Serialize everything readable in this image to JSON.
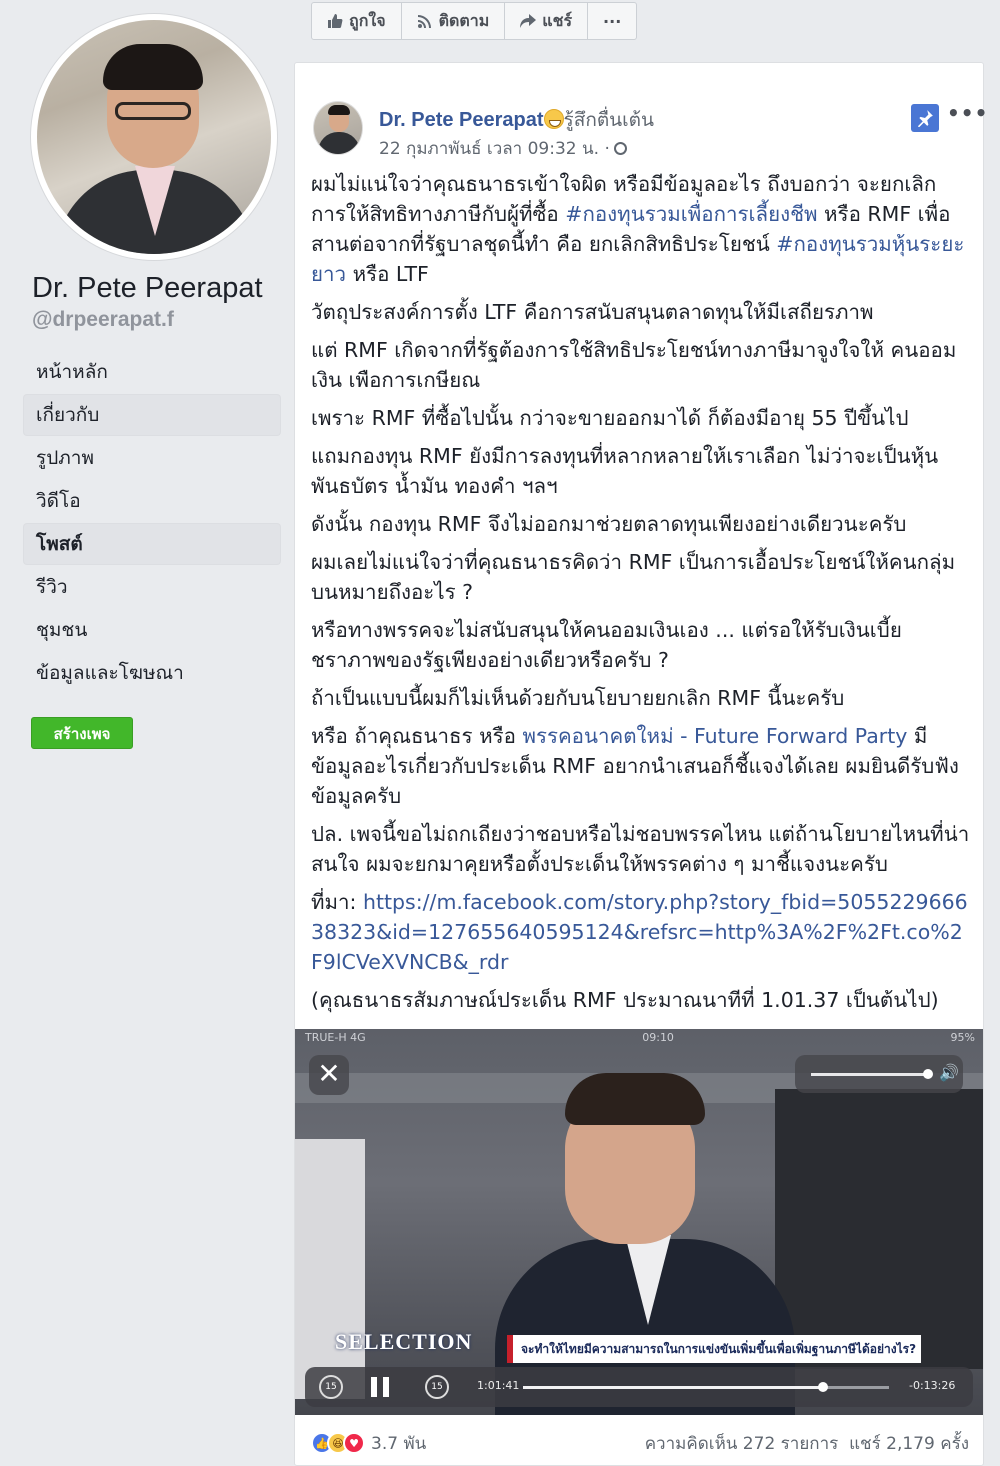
{
  "page": {
    "name": "Dr. Pete Peerapat",
    "handle": "@drpeerapat.f",
    "nav": [
      "หน้าหลัก",
      "เกี่ยวกับ",
      "รูปภาพ",
      "วิดีโอ",
      "โพสต์",
      "รีวิว",
      "ชุมชน",
      "ข้อมูลและโฆษณา"
    ],
    "create_page_label": "สร้างเพจ"
  },
  "topbar": {
    "like_label": "ถูกใจ",
    "follow_label": "ติดตาม",
    "share_label": "แชร์",
    "more_label": "···"
  },
  "post": {
    "author": "Dr. Pete Peerapat",
    "feeling": "รู้สึกตื่นเต้น",
    "timestamp": "22 กุมภาพันธ์ เวลา 09:32 น. ·",
    "more_label": "•••",
    "p1a": "ผมไม่แน่ใจว่าคุณธนาธรเข้าใจผิด หรือมีข้อมูลอะไร ถึงบอกว่า จะยกเลิกการให้สิทธิทางภาษีกับผู้ที่ซื้อ ",
    "hashtag1": "#กองทุนรวมเพื่อการเลี้ยงชีพ",
    "p1b": " หรือ RMF เพื่อสานต่อจากที่รัฐบาลชุดนี้ทำ คือ ยกเลิกสิทธิประโยชน์ ",
    "hashtag2": "#กองทุนรวมหุ้นระยะยาว",
    "p1c": " หรือ LTF",
    "p2": "วัตถุประสงค์การตั้ง LTF คือการสนับสนุนตลาดทุนให้มีเสถียรภาพ",
    "p3": "แต่ RMF เกิดจากที่รัฐต้องการใช้สิทธิประโยชน์ทางภาษีมาจูงใจให้ คนออมเงิน เพือการเกษียณ",
    "p4": "เพราะ RMF ที่ซื้อไปนั้น กว่าจะขายออกมาได้ ก็ต้องมีอายุ 55 ปีขึ้นไป",
    "p5": "แถมกองทุน RMF ยังมีการลงทุนที่หลากหลายให้เราเลือก ไม่ว่าจะเป็นหุ้น พันธบัตร น้ำมัน ทองคำ ฯลฯ",
    "p6": "ดังนั้น กองทุน RMF จึงไม่ออกมาช่วยตลาดทุนเพียงอย่างเดียวนะครับ",
    "p7": "ผมเลยไม่แน่ใจว่าที่คุณธนาธรคิดว่า RMF เป็นการเอื้อประโยชน์ให้คนกลุ่มบนหมายถึงอะไร ?",
    "p8": "หรือทางพรรคจะไม่สนับสนุนให้คนออมเงินเอง ... แต่รอให้รับเงินเบี้ยชราภาพของรัฐเพียงอย่างเดียวหรือครับ ?",
    "p9": "ถ้าเป็นแบบนี้ผมก็ไม่เห็นด้วยกับนโยบายยกเลิก RMF นี้นะครับ",
    "p10a": "หรือ ถ้าคุณธนาธร หรือ ",
    "p10link": "พรรคอนาคตใหม่ - Future Forward Party",
    "p10b": " มีข้อมูลอะไรเกี่ยวกับประเด็น RMF อยากนำเสนอก็ชี้แจงได้เลย ผมยินดีรับฟังข้อมูลครับ",
    "p11": "ปล. เพจนี้ขอไม่ถกเถียงว่าชอบหรือไม่ชอบพรรคไหน แต่ถ้านโยบายไหนที่น่าสนใจ ผมจะยกมาคุยหรือตั้งประเด็นให้พรรคต่าง ๆ มาชี้แจงนะครับ",
    "source_label": "ที่มา: ",
    "source_url": "https://m.facebook.com/story.php?story_fbid=505522966638323&id=127655640595124&refsrc=http%3A%2F%2Ft.co%2F9lCVeXVNCB&_rdr",
    "p12": "(คุณธนาธรสัมภาษณ์ประเด็น RMF ประมาณนาทีที่ 1.01.37 เป็นต้นไป)"
  },
  "video": {
    "carrier": "TRUE-H  4G",
    "clock": "09:10",
    "battery": "95%",
    "logo_text": "SELECTION",
    "caption": "จะทำให้ไทยมีความสามารถในการแข่งขันเพิ่มขึ้นเพื่อเพิ่มฐานภาษีได้อย่างไร?",
    "elapsed": "1:01:41",
    "remaining": "-0:13:26",
    "progress": 0.82,
    "volume": 0.95,
    "skip_back": "15",
    "skip_fwd": "15"
  },
  "footer": {
    "reaction_count": "3.7 พัน",
    "comments": "ความคิดเห็น 272 รายการ",
    "shares": "แชร์ 2,179 ครั้ง"
  },
  "colors": {
    "link": "#385898",
    "create_button": "#42b72a",
    "pin": "#4a76d4"
  }
}
